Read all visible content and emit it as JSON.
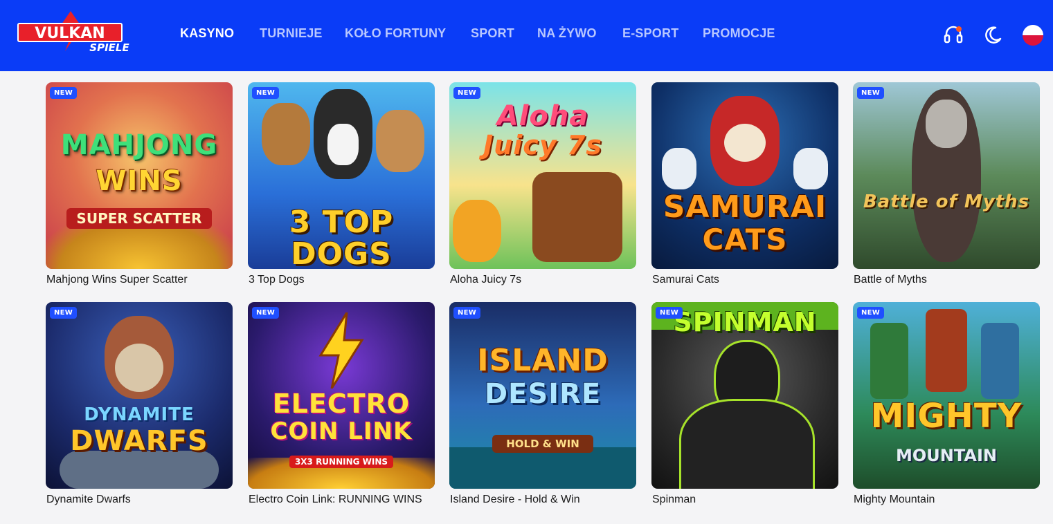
{
  "logo": {
    "text_main": "VULKAN",
    "text_sub": "SPIELE"
  },
  "nav": [
    {
      "label": "KASYNO",
      "active": true
    },
    {
      "label": "TURNIEJE",
      "active": false
    },
    {
      "label": "KOŁO FORTUNY",
      "active": false
    },
    {
      "label": "SPORT",
      "active": false
    },
    {
      "label": "NA ŻYWO",
      "active": false
    },
    {
      "label": "E-SPORT",
      "active": false
    },
    {
      "label": "PROMOCJE",
      "active": false
    }
  ],
  "header_icons": [
    "support-icon",
    "moon-icon",
    "poland-flag-icon"
  ],
  "games": [
    {
      "name": "Mahjong Wins Super Scatter",
      "badge": "NEW",
      "art": [
        "MAHJONG",
        "WINS"
      ],
      "art_sub": "SUPER SCATTER"
    },
    {
      "name": "3 Top Dogs",
      "badge": "NEW",
      "art": [
        "3 TOP DOGS"
      ],
      "art_sub": ""
    },
    {
      "name": "Aloha Juicy 7s",
      "badge": "NEW",
      "art": [
        "Aloha",
        "Juicy 7s"
      ],
      "art_sub": ""
    },
    {
      "name": "Samurai Cats",
      "badge": "",
      "art": [
        "SAMURAI",
        "CATS"
      ],
      "art_sub": ""
    },
    {
      "name": "Battle of Myths",
      "badge": "NEW",
      "art": [
        "Battle of Myths"
      ],
      "art_sub": ""
    },
    {
      "name": "Dynamite Dwarfs",
      "badge": "NEW",
      "art": [
        "DYNAMITE",
        "DWARFS"
      ],
      "art_sub": ""
    },
    {
      "name": "Electro Coin Link: RUNNING WINS",
      "badge": "NEW",
      "art": [
        "ELECTRO",
        "COIN LINK"
      ],
      "art_sub": "3X3 RUNNING WINS"
    },
    {
      "name": "Island Desire - Hold & Win",
      "badge": "NEW",
      "art": [
        "ISLAND",
        "DESIRE"
      ],
      "art_sub": "HOLD & WIN"
    },
    {
      "name": "Spinman",
      "badge": "NEW",
      "art": [
        "SPINMAN"
      ],
      "art_sub": ""
    },
    {
      "name": "Mighty Mountain",
      "badge": "NEW",
      "art": [
        "MIGHTY"
      ],
      "art_sub": "MOUNTAIN"
    }
  ],
  "colors": {
    "header": "#0a3cf7",
    "badge": "#1f4fff",
    "page_bg": "#f4f4f6"
  }
}
